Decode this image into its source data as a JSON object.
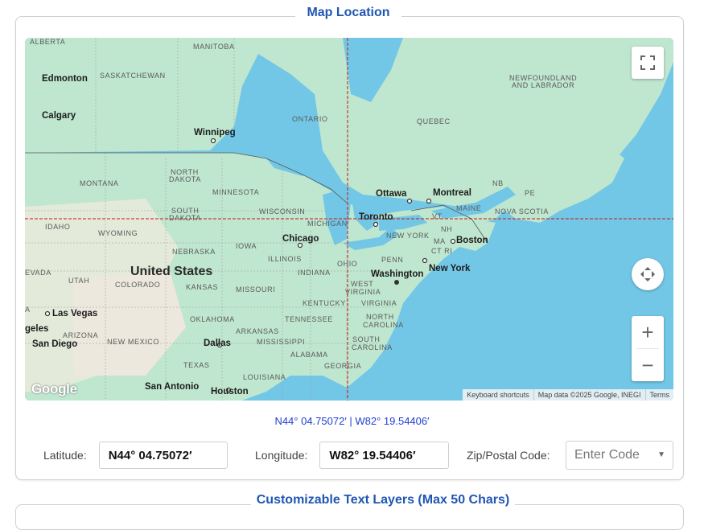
{
  "section_title": "Map Location",
  "map": {
    "provinces": {
      "alberta": "ALBERTA",
      "manitoba": "MANITOBA",
      "saskatchewan": "SASKATCHEWAN",
      "ontario": "ONTARIO",
      "quebec": "QUEBEC",
      "newfoundland_1": "NEWFOUNDLAND",
      "newfoundland_2": "AND LABRADOR",
      "nb": "NB",
      "pe": "PE",
      "nova_scotia": "NOVA SCOTIA"
    },
    "states": {
      "montana": "MONTANA",
      "north_dakota_1": "NORTH",
      "north_dakota_2": "DAKOTA",
      "minnesota": "MINNESOTA",
      "south_dakota_1": "SOUTH",
      "south_dakota_2": "DAKOTA",
      "wisconsin": "WISCONSIN",
      "michigan": "MICHIGAN",
      "idaho": "IDAHO",
      "wyoming": "WYOMING",
      "nebraska": "NEBRASKA",
      "iowa": "IOWA",
      "illinois": "ILLINOIS",
      "indiana": "INDIANA",
      "ohio": "OHIO",
      "penn": "PENN",
      "new_york": "NEW YORK",
      "maine": "MAINE",
      "vt": "VT",
      "nh": "NH",
      "ma": "MA",
      "ct_ri": "CT RI",
      "nevada": "EVADA",
      "utah": "UTAH",
      "colorado": "COLORADO",
      "kansas": "KANSAS",
      "missouri": "MISSOURI",
      "west_virginia_1": "WEST",
      "west_virginia_2": "VIRGINIA",
      "virginia": "VIRGINIA",
      "kentucky": "KENTUCKY",
      "tennessee": "TENNESSEE",
      "north_carolina_1": "NORTH",
      "north_carolina_2": "CAROLINA",
      "south_carolina_1": "SOUTH",
      "south_carolina_2": "CAROLINA",
      "arizona": "ARIZONA",
      "new_mexico": "NEW MEXICO",
      "oklahoma": "OKLAHOMA",
      "arkansas": "ARKANSAS",
      "mississippi": "MISSISSIPPI",
      "alabama": "ALABAMA",
      "georgia": "GEORGIA",
      "texas": "TEXAS",
      "louisiana": "LOUISIANA",
      "az_left": "A"
    },
    "cities": {
      "edmonton": "Edmonton",
      "calgary": "Calgary",
      "winnipeg": "Winnipeg",
      "ottawa": "Ottawa",
      "montreal": "Montreal",
      "toronto": "Toronto",
      "chicago": "Chicago",
      "boston": "Boston",
      "new_york": "New York",
      "washington": "Washington",
      "las_vegas": "Las Vegas",
      "los_angeles": "geles",
      "san_diego": "San Diego",
      "dallas": "Dallas",
      "san_antonio": "San Antonio",
      "houston": "Houston"
    },
    "country": "United States",
    "logo": "Google",
    "attribution": {
      "keyboard": "Keyboard shortcuts",
      "data": "Map data ©2025 Google, INEGI",
      "terms": "Terms"
    },
    "colors": {
      "water": "#73c7e6",
      "land": "#bfe6cf",
      "crosshair": "#c81414"
    }
  },
  "coordinates_display": "N44° 04.75072′ | W82° 19.54406′",
  "fields": {
    "latitude_label": "Latitude:",
    "latitude_value": "N44° 04.75072′",
    "longitude_label": "Longitude:",
    "longitude_value": "W82° 19.54406′",
    "zip_label": "Zip/Postal Code:",
    "zip_placeholder": "Enter Code"
  },
  "next_section_title": "Customizable Text Layers (Max 50 Chars)"
}
